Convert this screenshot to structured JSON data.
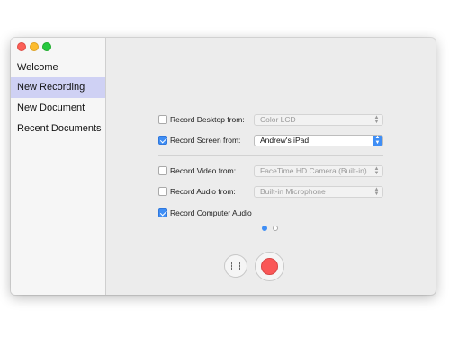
{
  "sidebar": {
    "items": [
      {
        "label": "Welcome",
        "selected": false
      },
      {
        "label": "New Recording",
        "selected": true
      },
      {
        "label": "New Document",
        "selected": false
      },
      {
        "label": "Recent Documents",
        "selected": false
      }
    ]
  },
  "options": {
    "desktop": {
      "label": "Record Desktop from:",
      "checked": false,
      "value": "Color LCD",
      "enabled": false
    },
    "screen": {
      "label": "Record Screen from:",
      "checked": true,
      "value": "Andrew's iPad",
      "enabled": true
    },
    "video": {
      "label": "Record Video from:",
      "checked": false,
      "value": "FaceTime HD Camera (Built-in)",
      "enabled": false
    },
    "audio": {
      "label": "Record Audio from:",
      "checked": false,
      "value": "Built-in Microphone",
      "enabled": false
    },
    "computer_audio": {
      "label": "Record Computer Audio",
      "checked": true
    }
  },
  "page_indicator": {
    "current": 1,
    "total": 2
  },
  "colors": {
    "accent": "#3f8ef5",
    "record": "#fa5757",
    "selection": "#cfd1f4"
  }
}
